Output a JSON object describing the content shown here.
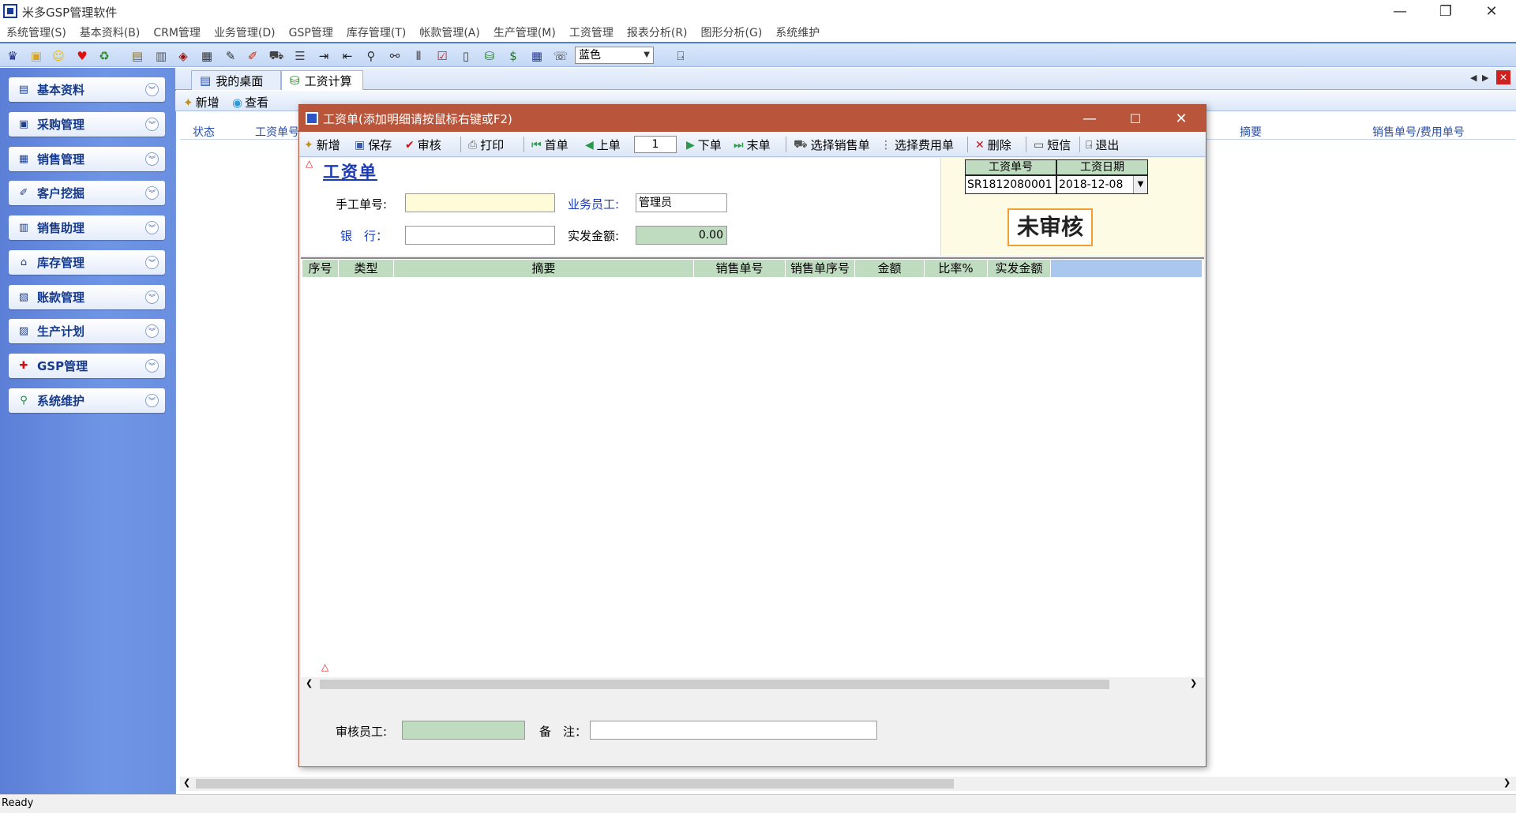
{
  "app": {
    "title": "米多GSP管理软件",
    "window_controls": {
      "minimize": "—",
      "restore": "❐",
      "close": "✕"
    }
  },
  "menu": [
    "系统管理(S)",
    "基本资料(B)",
    "CRM管理",
    "业务管理(D)",
    "GSP管理",
    "库存管理(T)",
    "帐款管理(A)",
    "生产管理(M)",
    "工资管理",
    "报表分析(R)",
    "图形分析(G)",
    "系统维护"
  ],
  "toolbar": {
    "theme_value": "蓝色"
  },
  "sidebar": {
    "items": [
      {
        "label": "基本资料",
        "icon": "book-icon"
      },
      {
        "label": "采购管理",
        "icon": "cart-icon"
      },
      {
        "label": "销售管理",
        "icon": "sales-icon"
      },
      {
        "label": "客户挖掘",
        "icon": "customer-icon"
      },
      {
        "label": "销售助理",
        "icon": "calendar-icon"
      },
      {
        "label": "库存管理",
        "icon": "warehouse-icon"
      },
      {
        "label": "账款管理",
        "icon": "ledger-icon"
      },
      {
        "label": "生产计划",
        "icon": "factory-icon"
      },
      {
        "label": "GSP管理",
        "icon": "gsp-icon"
      },
      {
        "label": "系统维护",
        "icon": "maintenance-icon"
      }
    ]
  },
  "tabs": [
    {
      "label": "我的桌面"
    },
    {
      "label": "工资计算"
    }
  ],
  "listbar": {
    "new": "新增",
    "view": "查看"
  },
  "list_columns": {
    "status": "状态",
    "no": "工资单号",
    "summary": "摘要",
    "sale_no": "销售单号/费用单号"
  },
  "dialog": {
    "title": "工资单(添加明细请按鼠标右键或F2)",
    "toolbar": {
      "new": "新增",
      "save": "保存",
      "audit": "审核",
      "print": "打印",
      "first": "首单",
      "prev": "上单",
      "page": "1",
      "next": "下单",
      "last": "末单",
      "select_sale": "选择销售单",
      "select_fee": "选择费用单",
      "delete": "删除",
      "sms": "短信",
      "exit": "退出"
    },
    "form": {
      "heading": "工资单",
      "manual_no_label": "手工单号:",
      "manual_no_value": "",
      "salesman_label": "业务员工:",
      "salesman_value": "管理员",
      "bank_label": "银　行：",
      "bank_value": "",
      "paid_label": "实发金额:",
      "paid_value": "0.00",
      "salary_no_label": "工资单号",
      "salary_no_value": "SR1812080001",
      "salary_date_label": "工资日期",
      "salary_date_value": "2018-12-08",
      "status_stamp": "未审核"
    },
    "grid_columns": [
      "序号",
      "类型",
      "摘要",
      "销售单号",
      "销售单序号",
      "金额",
      "比率%",
      "实发金额"
    ],
    "footer": {
      "auditor_label": "审核员工:",
      "auditor_value": "",
      "remark_label": "备　注：",
      "remark_value": ""
    }
  },
  "status_bar": "Ready"
}
